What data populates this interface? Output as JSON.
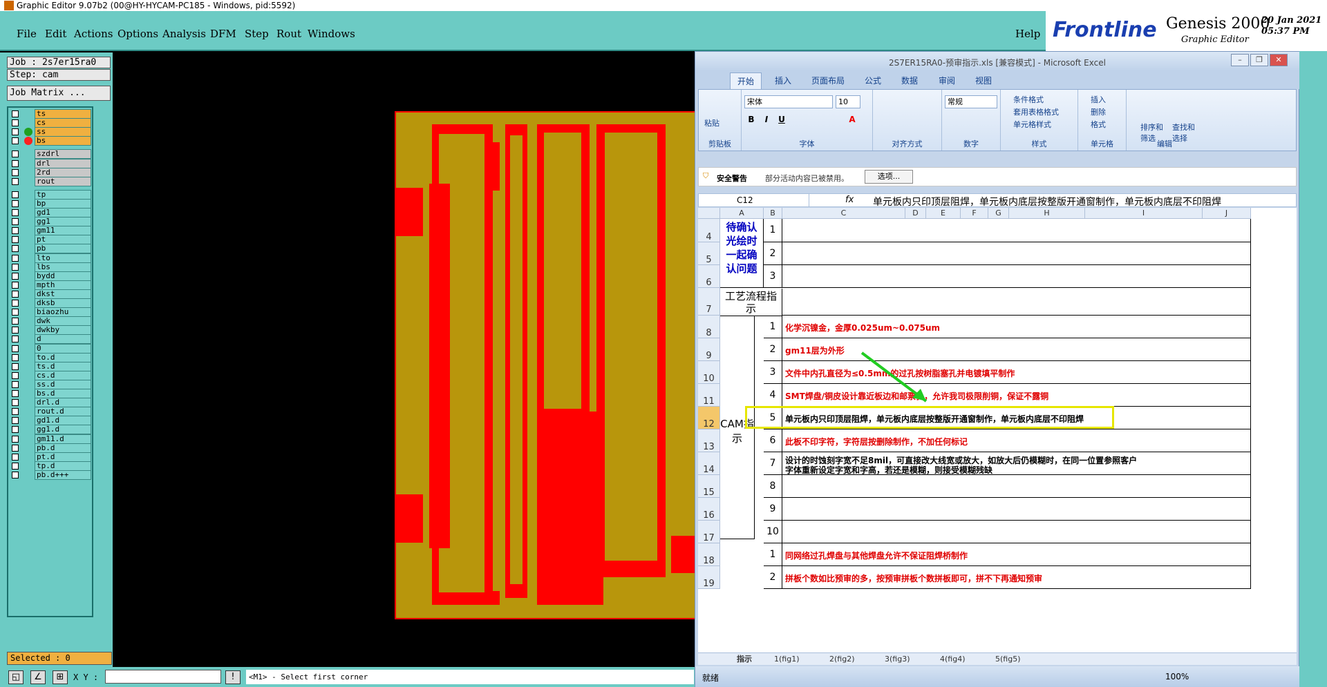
{
  "genesis": {
    "title": "Graphic Editor 9.07b2 (00@HY-HYCAM-PC185 - Windows, pid:5592)",
    "menu": [
      "File",
      "Edit",
      "Actions",
      "Options",
      "Analysis",
      "DFM",
      "Step",
      "Rout",
      "Windows"
    ],
    "help": "Help",
    "brand": {
      "logo": "Frontline",
      "product": "Genesis 2000",
      "subtitle": "Graphic Editor",
      "date": "20 Jan 2021",
      "time": "05:37 PM"
    },
    "job": "Job : 2s7er15ra0",
    "step": "Step: cam",
    "job_matrix": "Job Matrix ...",
    "layers": [
      "ts",
      "cs",
      "ss",
      "bs",
      "szdrl",
      "drl",
      "2rd",
      "rout",
      "tp",
      "bp",
      "gd1",
      "gg1",
      "gm11",
      "pt",
      "pb",
      "lto",
      "lbs",
      "bydd",
      "mpth",
      "dkst",
      "dksb",
      "biaozhu",
      "dwk",
      "dwkby",
      "d",
      "0",
      "to.d",
      "ts.d",
      "cs.d",
      "ss.d",
      "bs.d",
      "drl.d",
      "rout.d",
      "gd1.d",
      "gg1.d",
      "gm11.d",
      "pb.d",
      "pt.d",
      "tp.d",
      "pb.d+++"
    ],
    "selected": "Selected : 0",
    "xy_label": "X Y :",
    "status_msg": "<M1> - Select first corner",
    "colors": {
      "teal": "#6ccbc4",
      "board": "#b8960c",
      "copper": "#ff0000",
      "active": "#f0b040"
    }
  },
  "excel": {
    "title": "2S7ER15RA0-预审指示.xls [兼容模式] - Microsoft Excel",
    "tabs": [
      "开始",
      "插入",
      "页面布局",
      "公式",
      "数据",
      "审阅",
      "视图"
    ],
    "ribbon": {
      "paste": "粘贴",
      "clipboard": "剪贴板",
      "font_name": "宋体",
      "font_size": "10",
      "font_group": "字体",
      "align_group": "对齐方式",
      "number_format": "常规",
      "number_group": "数字",
      "style_items": [
        "条件格式",
        "套用表格格式",
        "单元格样式"
      ],
      "style_group": "样式",
      "cell_items": [
        "插入",
        "删除",
        "格式"
      ],
      "cell_group": "单元格",
      "edit_items": [
        "排序和筛选",
        "查找和选择"
      ],
      "edit_group": "编辑"
    },
    "security": {
      "label": "安全警告",
      "message": "部分活动内容已被禁用。",
      "button": "选项..."
    },
    "namebox": "C12",
    "fx": "fx",
    "formula": "单元板内只印顶层阻焊，单元板内底层按整版开通窗制作，单元板内底层不印阻焊",
    "columns": [
      "A",
      "B",
      "C",
      "D",
      "E",
      "F",
      "G",
      "H",
      "I",
      "J"
    ],
    "pending_label": "待确认光绘时一起确认问题",
    "process_label": "工艺流程指示",
    "cam_label": "CAM指示",
    "rows": [
      {
        "row": "4",
        "num": "1",
        "text": "",
        "color": "blk"
      },
      {
        "row": "5",
        "num": "2",
        "text": "",
        "color": "blk"
      },
      {
        "row": "6",
        "num": "3",
        "text": "",
        "color": "blk"
      },
      {
        "row": "7",
        "num": "",
        "text": "",
        "color": "blk"
      },
      {
        "row": "8",
        "num": "1",
        "text": "化学沉镍金，金厚0.025um~0.075um",
        "color": "red"
      },
      {
        "row": "9",
        "num": "2",
        "text": "gm11层为外形",
        "color": "red"
      },
      {
        "row": "10",
        "num": "3",
        "text": "文件中内孔直径为≤0.5mm的过孔按树脂塞孔并电镀填平制作",
        "color": "red"
      },
      {
        "row": "11",
        "num": "4",
        "text": "SMT焊盘/铜皮设计靠近板边和邮票孔，允许我司极限削铜，保证不露铜",
        "color": "red"
      },
      {
        "row": "12",
        "num": "5",
        "text": "单元板内只印顶层阻焊，单元板内底层按整版开通窗制作，单元板内底层不印阻焊",
        "color": "blk"
      },
      {
        "row": "13",
        "num": "6",
        "text": "此板不印字符，字符层按删除制作，不加任何标记",
        "color": "red"
      },
      {
        "row": "14",
        "num": "7",
        "text": "设计的时蚀刻字宽不足8mil，可直接改大线宽或放大，如放大后仍模糊时，在同一位置参照客户",
        "text2": "字体重新设定字宽和字高，若还是模糊，则接受模糊残缺",
        "color": "blk"
      },
      {
        "row": "15",
        "num": "8",
        "text": "",
        "color": "blk"
      },
      {
        "row": "16",
        "num": "9",
        "text": "",
        "color": "blk"
      },
      {
        "row": "17",
        "num": "10",
        "text": "",
        "color": "blk"
      },
      {
        "row": "18",
        "num": "1",
        "text": "同网络过孔焊盘与其他焊盘允许不保证阻焊桥制作",
        "color": "red"
      },
      {
        "row": "19",
        "num": "2",
        "text": "拼板个数如比预审的多，按预审拼板个数拼板即可，拼不下再通知预审",
        "color": "red"
      }
    ],
    "sheet_tabs": [
      "指示",
      "1(fig1)",
      "2(fig2)",
      "3(fig3)",
      "4(fig4)",
      "5(fig5)"
    ],
    "status": "就绪",
    "zoom": "100%"
  }
}
